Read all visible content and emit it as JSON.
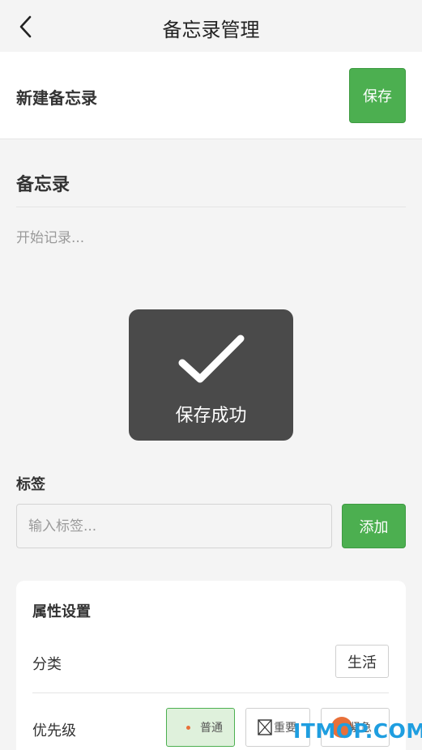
{
  "header": {
    "title": "备忘录管理",
    "back_icon": "chevron-left-icon"
  },
  "new_memo": {
    "title": "新建备忘录",
    "save_label": "保存"
  },
  "memo": {
    "title": "备忘录",
    "body_placeholder": "开始记录..."
  },
  "toast": {
    "icon": "checkmark-icon",
    "message": "保存成功"
  },
  "tags": {
    "label": "标签",
    "input_placeholder": "输入标签...",
    "add_label": "添加"
  },
  "attributes": {
    "title": "属性设置",
    "category_label": "分类",
    "category_value": "生活",
    "priority_label": "优先级",
    "priority_options": [
      {
        "label": "普通",
        "selected": true
      },
      {
        "label": "重要",
        "selected": false
      },
      {
        "label": "紧急",
        "selected": false
      }
    ]
  },
  "watermark": "ITMOP.COM",
  "colors": {
    "accent": "#4caf50",
    "toast_bg": "#4a4a4a",
    "priority_dot": "#e8703a",
    "watermark": "#1f9ee0"
  }
}
